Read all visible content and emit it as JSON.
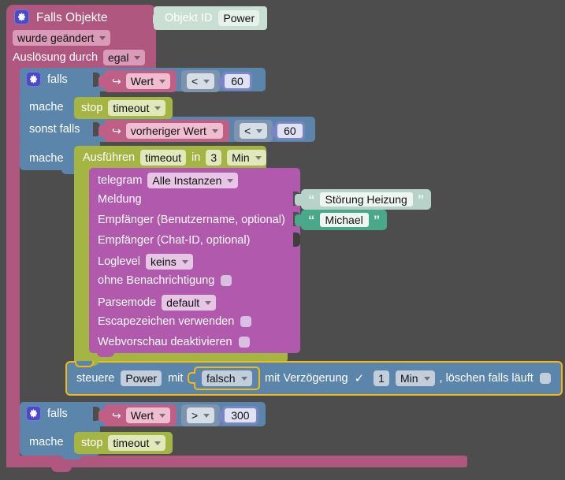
{
  "app": {
    "kind": "blockly-script-editor",
    "background": "#4d4d4d"
  },
  "colors": {
    "event_pink": "#b0577f",
    "if_blue": "#5b85ab",
    "timeout_green": "#a5b544",
    "telegram_purple": "#b059ad",
    "variable_pink": "#bf5f86",
    "compare_slate": "#7e93ad",
    "number_blue": "#7a86c4",
    "string_green": "#4aa88a",
    "string_green_selected": "#b7d3c9",
    "objekt_id_green": "#c9dfd3",
    "highlight_orange": "#f5b913"
  },
  "event_block": {
    "gear_icon": "gear-icon",
    "title": "Falls Objekte",
    "trigger_dropdown": "wurde geändert",
    "source_label": "Auslösung durch",
    "source_dropdown": "egal",
    "object_id_block": {
      "label": "Objekt ID",
      "value": "Power"
    }
  },
  "if_block_1": {
    "gear_icon": "gear-icon",
    "if_label": "falls",
    "condition": {
      "variable_icon": "return-arrow-icon",
      "variable": "Wert",
      "operator": "<",
      "number": "60"
    },
    "do_label": "mache",
    "do_statement": {
      "verb": "stop",
      "name": "timeout"
    },
    "else_if_label": "sonst falls",
    "else_condition": {
      "variable_icon": "return-arrow-icon",
      "variable": "vorheriger Wert",
      "operator": "<",
      "number": "60"
    },
    "else_do_label": "mache"
  },
  "timeout_block": {
    "verb": "Ausführen",
    "name": "timeout",
    "in_label": "in",
    "amount": "3",
    "unit": "Min"
  },
  "telegram_block": {
    "title": "telegram",
    "instance": "Alle Instanzen",
    "rows": [
      {
        "label": "Meldung",
        "type": "value"
      },
      {
        "label": "Empfänger (Benutzername, optional)",
        "type": "value"
      },
      {
        "label": "Empfänger (Chat-ID, optional)",
        "type": "value"
      },
      {
        "label": "Loglevel",
        "type": "dropdown",
        "value": "keins"
      },
      {
        "label": "ohne Benachrichtigung",
        "type": "checkbox",
        "checked": false
      },
      {
        "label": "Parsemode",
        "type": "dropdown",
        "value": "default"
      },
      {
        "label": "Escapezeichen verwenden",
        "type": "checkbox",
        "checked": false
      },
      {
        "label": "Webvorschau deaktivieren",
        "type": "checkbox",
        "checked": false
      }
    ]
  },
  "text_blocks": [
    {
      "text": "Störung Heizung",
      "selected": true,
      "open_quote": "“",
      "close_quote": "”"
    },
    {
      "text": "Michael",
      "selected": false,
      "open_quote": "“",
      "close_quote": "”"
    }
  ],
  "control_block": {
    "selected": true,
    "verb": "steuere",
    "target": "Power",
    "with_label": "mit",
    "value": "falsch",
    "delay_label": "mit Verzögerung",
    "delay_checked": true,
    "delay_check_icon": "check-icon",
    "delay_amount": "1",
    "delay_unit": "Min",
    "clear_label": ", löschen falls läuft",
    "clear_checked": false
  },
  "if_block_2": {
    "gear_icon": "gear-icon",
    "if_label": "falls",
    "condition": {
      "variable_icon": "return-arrow-icon",
      "variable": "Wert",
      "operator": ">",
      "number": "300"
    },
    "do_label": "mache",
    "do_statement": {
      "verb": "stop",
      "name": "timeout"
    }
  }
}
